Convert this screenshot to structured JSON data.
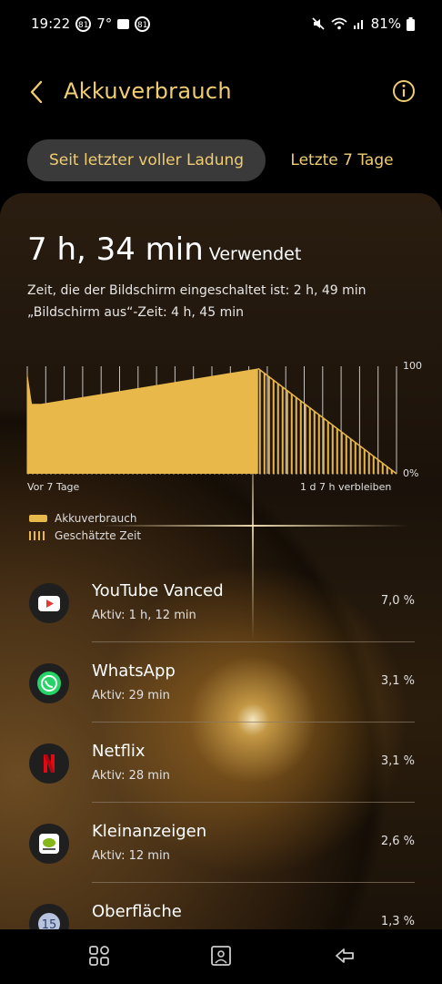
{
  "status": {
    "time": "19:22",
    "badge1": "81",
    "temp": "7°",
    "badge2": "81",
    "battery": "81%"
  },
  "header": {
    "title": "Akkuverbrauch"
  },
  "tabs": [
    {
      "label": "Seit letzter voller Ladung",
      "active": true
    },
    {
      "label": "Letzte 7 Tage",
      "active": false
    }
  ],
  "summary": {
    "used_time": "7 h, 34 min",
    "used_label": "Verwendet",
    "screen_on": "Zeit, die der Bildschirm eingeschaltet ist: 2 h, 49 min",
    "screen_off": "„Bildschirm aus“-Zeit: 4 h, 45 min"
  },
  "chart_data": {
    "type": "area",
    "ylabel_top": "100",
    "ylabel_bottom": "0%",
    "x_start_label": "Vor 7 Tage",
    "x_end_label": "1 d 7 h verbleiben",
    "ylim": [
      0,
      100
    ],
    "series": [
      {
        "name": "Akkuverbrauch",
        "x": [
          0,
          0.02,
          0.06,
          1.0
        ],
        "values": [
          94,
          65,
          65,
          98
        ]
      },
      {
        "name": "Geschätzte Zeit",
        "x": [
          1.0,
          1.6
        ],
        "values": [
          98,
          0
        ]
      }
    ],
    "legend": [
      {
        "label": "Akkuverbrauch",
        "style": "solid"
      },
      {
        "label": "Geschätzte Zeit",
        "style": "striped"
      }
    ],
    "color": "#e8b84a"
  },
  "apps": [
    {
      "name": "YouTube Vanced",
      "active": "Aktiv: 1 h, 12 min",
      "percent": "7,0 %",
      "icon": "youtube-vanced-icon"
    },
    {
      "name": "WhatsApp",
      "active": "Aktiv: 29 min",
      "percent": "3,1 %",
      "icon": "whatsapp-icon"
    },
    {
      "name": "Netflix",
      "active": "Aktiv: 28 min",
      "percent": "3,1 %",
      "icon": "netflix-icon"
    },
    {
      "name": "Kleinanzeigen",
      "active": "Aktiv: 12 min",
      "percent": "2,6 %",
      "icon": "kleinanzeigen-icon"
    },
    {
      "name": "Oberfläche",
      "active": "",
      "percent": "1,3 %",
      "icon": "oberflaeche-icon"
    }
  ],
  "colors": {
    "accent": "#f0cd72",
    "bar": "#e8b84a"
  }
}
